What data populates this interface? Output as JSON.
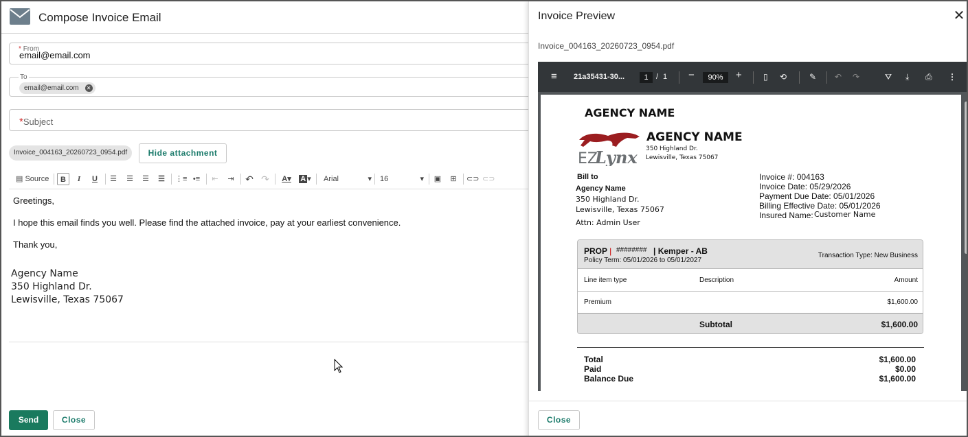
{
  "compose": {
    "title": "Compose Invoice Email",
    "from": {
      "label": "From",
      "value": "email@email.com"
    },
    "to": {
      "label": "To",
      "chip": "email@email.com"
    },
    "subject": {
      "label": "Subject"
    },
    "attachment": {
      "filename": "Invoice_004163_20260723_0954.pdf",
      "hide_label": "Hide attachment"
    },
    "toolbar": {
      "source_label": "Source",
      "font": "Arial",
      "size": "16"
    },
    "body": {
      "greeting": "Greetings,",
      "message": "I hope this email finds you well. Please find the attached invoice, pay at your earliest convenience.",
      "closing": "Thank you,",
      "signature": [
        "Agency Name",
        "350 Highland Dr.",
        "Lewisville, Texas 75067"
      ]
    },
    "send_label": "Send",
    "close_label": "Close"
  },
  "preview": {
    "title": "Invoice Preview",
    "filename": "Invoice_004163_20260723_0954.pdf",
    "close_label": "Close",
    "pdf_toolbar": {
      "doc_name": "21a35431-30...",
      "page_current": "1",
      "page_sep": "/",
      "page_total": "1",
      "zoom": "90%"
    },
    "invoice": {
      "agency_header": "AGENCY NAME",
      "logo_text_ez": "EZ",
      "logo_text_lynx": "Lynx",
      "agency_name": "AGENCY NAME",
      "agency_street": "350 Highland Dr.",
      "agency_city": "Lewisville, Texas 75067",
      "bill_to_label": "Bill to",
      "bill_name": "Agency Name",
      "bill_street": "350 Highland Dr.",
      "bill_city": "Lewisville, Texas 75067",
      "attn": "Attn: Admin User",
      "invoice_number": "Invoice #: 004163",
      "invoice_date": "Invoice Date: 05/29/2026",
      "payment_due": "Payment Due Date: 05/01/2026",
      "billing_effective": "Billing Effective Date: 05/01/2026",
      "insured_label": "Insured Name:",
      "insured_value": "Customer Name",
      "policy": {
        "type": "PROP",
        "pipe": "|",
        "number": "########",
        "carrier": "| Kemper - AB",
        "term": "Policy Term: 05/01/2026 to 05/01/2027",
        "transaction": "Transaction Type: New Business",
        "headers": [
          "Line item type",
          "Description",
          "Amount"
        ],
        "rows": [
          {
            "type": "Premium",
            "description": "",
            "amount": "$1,600.00"
          }
        ],
        "subtotal_label": "Subtotal",
        "subtotal_value": "$1,600.00"
      },
      "totals": [
        {
          "label": "Total",
          "value": "$1,600.00"
        },
        {
          "label": "Paid",
          "value": "$0.00"
        },
        {
          "label": "Balance Due",
          "value": "$1,600.00"
        }
      ]
    }
  },
  "colors": {
    "accent": "#1a7a5e",
    "accent_text": "#1a7a6a",
    "required": "#d32f2f",
    "logo_red": "#9b1d20",
    "pdf_toolbar": "#323639",
    "pdf_bg": "#525659"
  }
}
